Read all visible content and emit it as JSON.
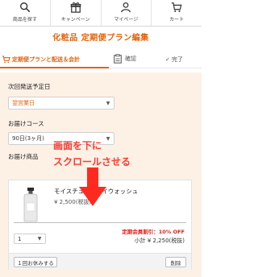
{
  "nav": {
    "items": [
      {
        "label": "商品を探す",
        "icon": "search-icon"
      },
      {
        "label": "キャンペーン",
        "icon": "gift-icon"
      },
      {
        "label": "マイページ",
        "icon": "user-icon"
      },
      {
        "label": "カート",
        "icon": "cart-icon"
      }
    ]
  },
  "page_title": "化粧品 定期便プラン編集",
  "steps": {
    "active": "定期便プランと配送＆会計",
    "confirm": "確認",
    "done": "完了"
  },
  "form": {
    "next_delivery_label": "次回発送予定日",
    "next_delivery_value": "翌営業日",
    "course_label": "お届けコース",
    "course_value": "90日(3ヶ月)",
    "items_label": "お届け商品"
  },
  "overlay": {
    "line1": "画面を下に",
    "line2": "スクロールさせる"
  },
  "product": {
    "name": "モイスチュ",
    "name_tail": "イウォッシュ",
    "price": "¥ 2,500(税抜)",
    "discount": "定期会員割引：10% OFF",
    "quantity": "1",
    "subtotal": "小計 ¥ 2,250(税抜)",
    "skip_button": "１回お休みする",
    "delete_button": "削除"
  },
  "colors": {
    "accent": "#e8610a",
    "overlay": "#ff3a2f",
    "background": "#fdf1e6",
    "discount": "#e0201a"
  }
}
